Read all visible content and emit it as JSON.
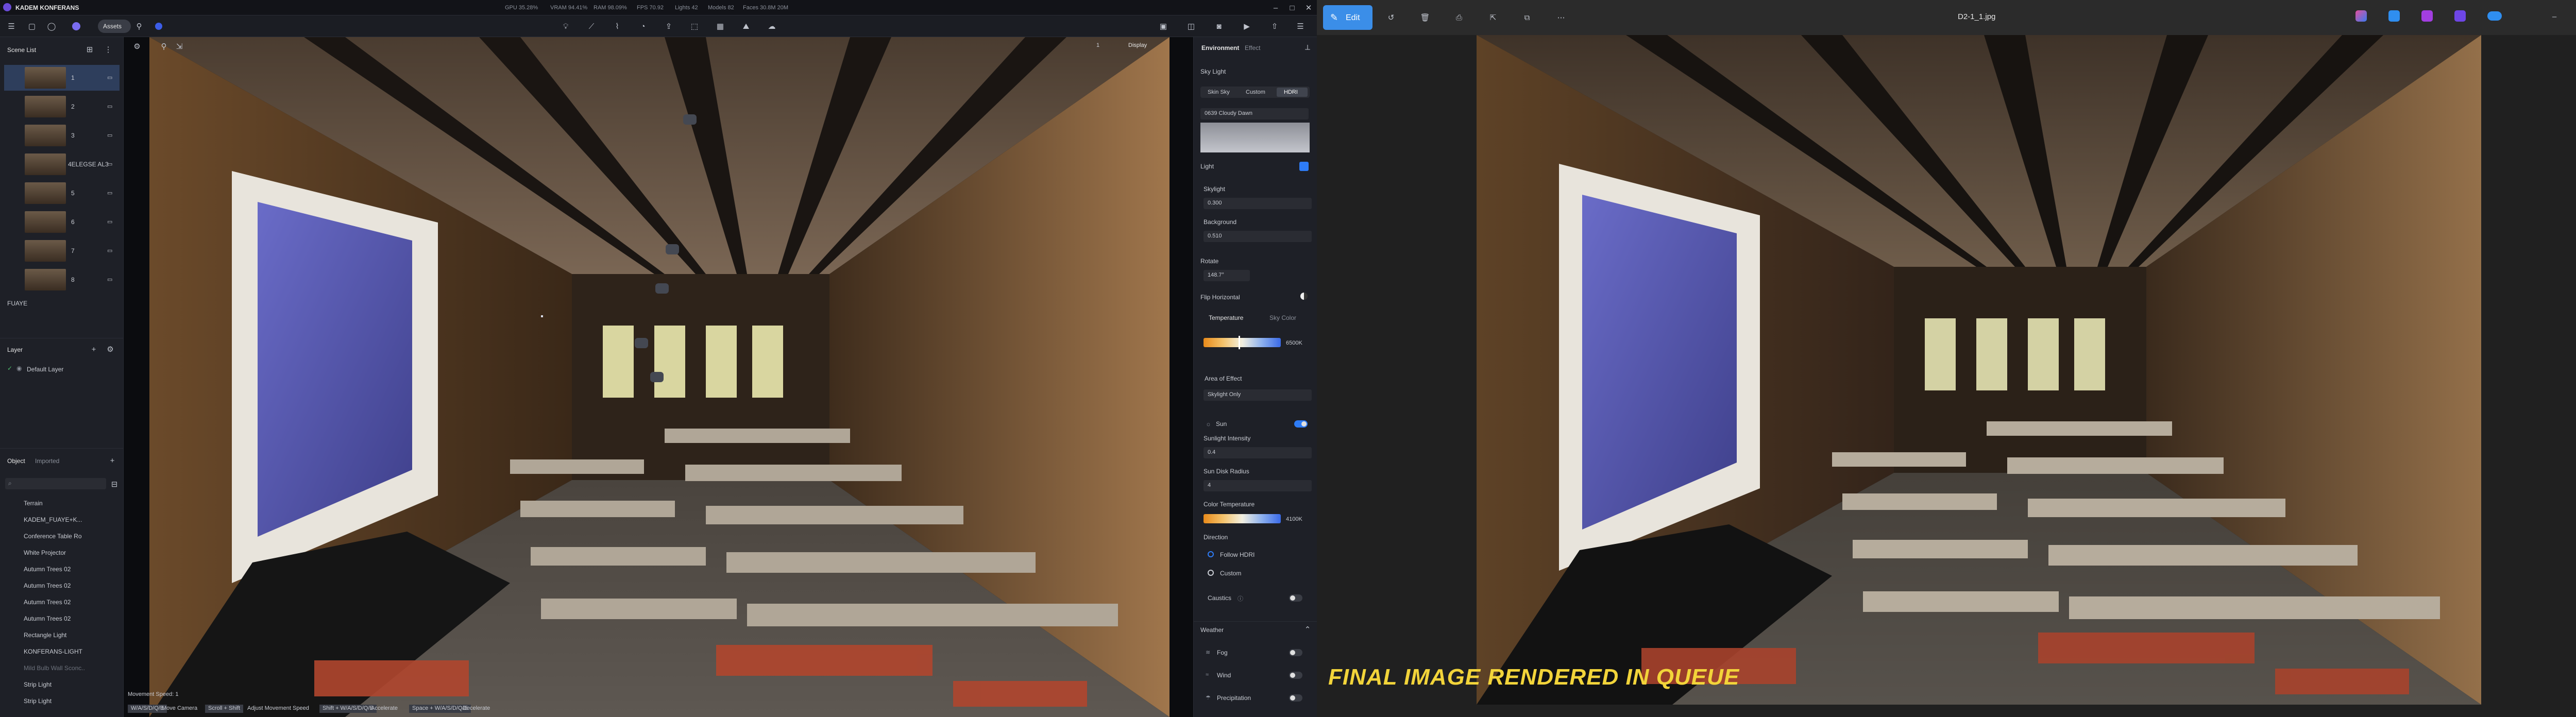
{
  "app": {
    "title": "KADEM KONFERANS",
    "stats": {
      "gpu": "GPU 35.28%",
      "vram": "VRAM 94.41%",
      "ram": "RAM 98.09%",
      "fps": "FPS 70.92",
      "lights": "Lights 42",
      "models": "Models 82",
      "faces": "Faces 30.8M 20M"
    },
    "assets_label": "Assets",
    "tag_label": "Tag"
  },
  "left_panel": {
    "scene_list_title": "Scene List",
    "scenes": [
      {
        "label": "1"
      },
      {
        "label": "2"
      },
      {
        "label": "3"
      },
      {
        "label": "4ELEGSE AL3"
      },
      {
        "label": "5"
      },
      {
        "label": "6"
      },
      {
        "label": "7"
      },
      {
        "label": "8"
      }
    ],
    "floor_group": "FUAYE",
    "layer_title": "Layer",
    "layer_items": [
      {
        "label": "Default Layer"
      }
    ],
    "object_tab": "Object",
    "imported_tab": "Imported",
    "objects": [
      {
        "label": "Terrain"
      },
      {
        "label": "KADEM_FUAYE+K..."
      },
      {
        "label": "Conference Table Ro"
      },
      {
        "label": "White Projector"
      },
      {
        "label": "Autumn Trees 02"
      },
      {
        "label": "Autumn Trees 02"
      },
      {
        "label": "Autumn Trees 02"
      },
      {
        "label": "Autumn Trees 02"
      },
      {
        "label": "Rectangle Light"
      },
      {
        "label": "KONFERANS-LIGHT"
      },
      {
        "label": "Mild Bulb Wall Sconc.."
      },
      {
        "label": "Strip Light"
      },
      {
        "label": "Strip Light"
      }
    ]
  },
  "viewport": {
    "display_label": "Display",
    "zoom_label": "1",
    "movement_speed": "Movement Speed: 1",
    "hints": [
      {
        "key": "W/A/S/D/Q/E",
        "action": "Move Camera"
      },
      {
        "key": "Scroll + Shift",
        "action": "Adjust Movement Speed"
      },
      {
        "key": "Shift + W/A/S/D/Q/E",
        "action": "Accelerate"
      },
      {
        "key": "Space + W/A/S/D/Q/E",
        "action": "Decelerate"
      }
    ]
  },
  "right_panel": {
    "tabs": [
      "Environment",
      "Effect"
    ],
    "sky_light_title": "Sky Light",
    "sky_modes": [
      "Skin Sky",
      "Custom",
      "HDRI"
    ],
    "hdri_name": "0639 Cloudy Dawn",
    "light_title": "Light",
    "skylight_label": "Skylight",
    "skylight_value": "0.300",
    "background_label": "Background",
    "background_value": "0.510",
    "rotate_label": "Rotate",
    "rotate_value": "148.7°",
    "flip_label": "Flip Horizontal",
    "color_tabs": [
      "Temperature",
      "Sky Color"
    ],
    "temperature_value": "6500K",
    "area_label": "Area of Effect",
    "area_value": "Skylight Only",
    "sun_label": "Sun",
    "sunlight_intensity_label": "Sunlight Intensity",
    "sunlight_intensity_value": "0.4",
    "sun_disk_label": "Sun Disk Radius",
    "sun_disk_value": "4",
    "color_temp_label": "Color Temperature",
    "color_temp_value": "4100K",
    "direction_label": "Direction",
    "direction_options": [
      "Follow HDRI",
      "Custom"
    ],
    "caustics_label": "Caustics",
    "weather_title": "Weather",
    "weather_items": [
      "Fog",
      "Wind",
      "Precipitation"
    ]
  },
  "photos": {
    "edit_label": "Edit",
    "file_name": "D2-1_1.jpg",
    "overlay_caption": "FINAL IMAGE RENDERED IN QUEUE"
  },
  "colors": {
    "accent": "#2e7cf6",
    "caption_yellow": "#f2d43a",
    "edit_button": "#3b8ee8"
  }
}
